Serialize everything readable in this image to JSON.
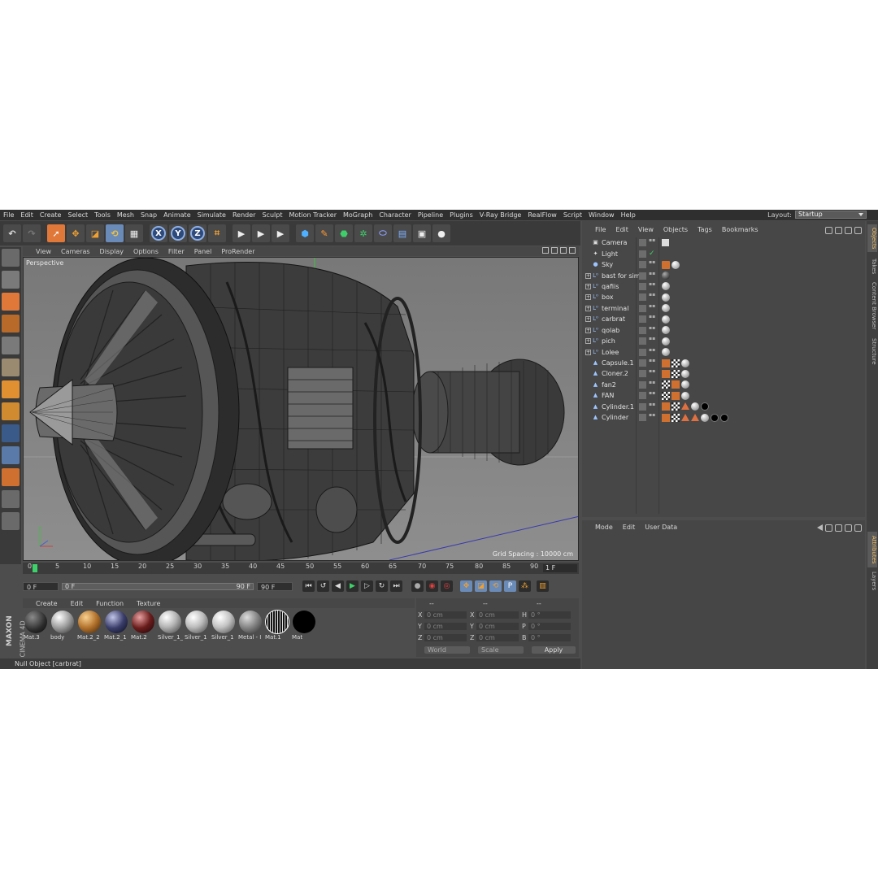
{
  "menubar": {
    "items": [
      "File",
      "Edit",
      "Create",
      "Select",
      "Tools",
      "Mesh",
      "Snap",
      "Animate",
      "Simulate",
      "Render",
      "Sculpt",
      "Motion Tracker",
      "MoGraph",
      "Character",
      "Pipeline",
      "Plugins",
      "V-Ray Bridge",
      "RealFlow",
      "Script",
      "Window",
      "Help"
    ],
    "layout_label": "Layout:",
    "layout_value": "Startup"
  },
  "toolbar": {
    "axis_x": "X",
    "axis_y": "Y",
    "axis_z": "Z"
  },
  "viewport": {
    "menu": [
      "View",
      "Cameras",
      "Display",
      "Options",
      "Filter",
      "Panel",
      "ProRender"
    ],
    "label": "Perspective",
    "grid_spacing": "Grid Spacing : 10000 cm"
  },
  "timeline": {
    "ticks": [
      "0",
      "5",
      "10",
      "15",
      "20",
      "25",
      "30",
      "35",
      "40",
      "45",
      "50",
      "55",
      "60",
      "65",
      "70",
      "75",
      "80",
      "85",
      "90"
    ],
    "current_frame": "1 F"
  },
  "transport": {
    "start_field": "0 F",
    "range_start": "0 F",
    "range_end": "90 F",
    "end_field": "90 F"
  },
  "materials": {
    "menu": [
      "Create",
      "Edit",
      "Function",
      "Texture"
    ],
    "items": [
      {
        "name": "Mat.3",
        "color": "#2a2a2a"
      },
      {
        "name": "body",
        "color": "#9a9a9a"
      },
      {
        "name": "Mat.2_2",
        "color": "#b0702a"
      },
      {
        "name": "Mat.2_1",
        "color": "#3a3e6a"
      },
      {
        "name": "Mat.2",
        "color": "#6a1c1c"
      },
      {
        "name": "Silver_1_",
        "color": "#b5b5b5"
      },
      {
        "name": "Silver_1",
        "color": "#bdbdbd"
      },
      {
        "name": "Silver_1",
        "color": "#c4c4c4"
      },
      {
        "name": "Metal - I",
        "color": "#8a8a8a"
      },
      {
        "name": "Mat.1",
        "color": "#141414"
      },
      {
        "name": "Mat",
        "color": "#000000"
      }
    ],
    "logo_top": "MAXON",
    "logo_bottom": "CINEMA 4D"
  },
  "coords": {
    "headers": [
      "--",
      "--",
      "--"
    ],
    "rows": [
      {
        "a": "X",
        "av": "0 cm",
        "b": "X",
        "bv": "0 cm",
        "c": "H",
        "cv": "0 °"
      },
      {
        "a": "Y",
        "av": "0 cm",
        "b": "Y",
        "bv": "0 cm",
        "c": "P",
        "cv": "0 °"
      },
      {
        "a": "Z",
        "av": "0 cm",
        "b": "Z",
        "bv": "0 cm",
        "c": "B",
        "cv": "0 °"
      }
    ],
    "world": "World",
    "scale": "Scale",
    "apply": "Apply"
  },
  "status": "Null Object [carbrat]",
  "objects": {
    "menu": [
      "File",
      "Edit",
      "View",
      "Objects",
      "Tags",
      "Bookmarks"
    ],
    "rows": [
      {
        "name": "Camera",
        "icon": "camera-icon",
        "expand": false
      },
      {
        "name": "Light",
        "icon": "light-icon",
        "expand": false
      },
      {
        "name": "Sky",
        "icon": "sky-icon",
        "expand": false
      },
      {
        "name": "bast for sim",
        "icon": "null-icon",
        "expand": true
      },
      {
        "name": "qafiis",
        "icon": "null-icon",
        "expand": true
      },
      {
        "name": "box",
        "icon": "null-icon",
        "expand": true
      },
      {
        "name": "terminal",
        "icon": "null-icon",
        "expand": true
      },
      {
        "name": "carbrat",
        "icon": "null-icon",
        "expand": true
      },
      {
        "name": "qolab",
        "icon": "null-icon",
        "expand": true
      },
      {
        "name": "pich",
        "icon": "null-icon",
        "expand": true
      },
      {
        "name": "Lolee",
        "icon": "null-icon",
        "expand": true
      },
      {
        "name": "Capsule.1",
        "icon": "polygon-icon",
        "expand": false
      },
      {
        "name": "Cloner.2",
        "icon": "polygon-icon",
        "expand": false
      },
      {
        "name": "fan2",
        "icon": "polygon-icon",
        "expand": false
      },
      {
        "name": "FAN",
        "icon": "polygon-icon",
        "expand": false
      },
      {
        "name": "Cylinder.1",
        "icon": "polygon-icon",
        "expand": false
      },
      {
        "name": "Cylinder",
        "icon": "polygon-icon",
        "expand": false
      }
    ]
  },
  "attributes": {
    "menu": [
      "Mode",
      "Edit",
      "User Data"
    ]
  },
  "sidetabs": [
    "Objects",
    "Takes",
    "Content Browser",
    "Structure",
    "Attributes",
    "Layers"
  ]
}
